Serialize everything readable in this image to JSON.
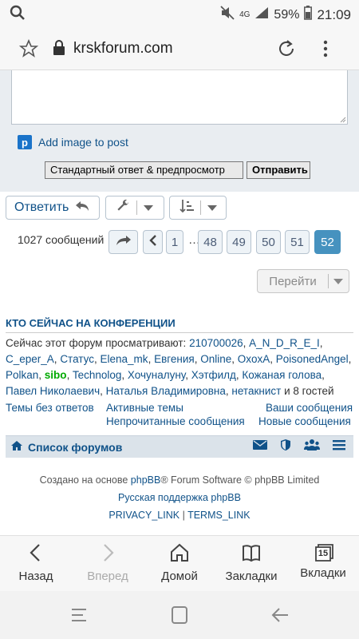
{
  "status_bar": {
    "battery": "59%",
    "time": "21:09",
    "network": "4G"
  },
  "browser": {
    "url": "krskforum.com"
  },
  "reply_form": {
    "add_image_label": "Add image to post",
    "preview_button": "Стандартный ответ & предпросмотр",
    "submit_button": "Отправить"
  },
  "actions": {
    "reply_label": "Ответить"
  },
  "pagination": {
    "post_count": "1027 сообщений",
    "ellipsis": "…",
    "pages": [
      "1",
      "48",
      "49",
      "50",
      "51",
      "52"
    ],
    "current_page": "52"
  },
  "jump": {
    "label": "Перейти"
  },
  "online": {
    "title": "КТО СЕЙЧАС НА КОНФЕРЕНЦИИ",
    "intro": "Сейчас этот форум просматривают: ",
    "users": [
      "210700026",
      "A_N_D_R_E_I",
      "C_eper_A",
      "Статус",
      "Elena_mk",
      "Евгения",
      "Online",
      "OxoxA",
      "PoisonedAngel",
      "Polkan",
      "sibo",
      "Technolog",
      "Хочуналуну",
      "Хэтфилд",
      "Кожаная голова",
      "Павел Николаевич",
      "Наталья Владимировна",
      "нетакнист"
    ],
    "highlighted_user": "sibo",
    "guests_text": " и 8 гостей"
  },
  "quick_links": {
    "unanswered": "Темы без ответов",
    "active": "Активные темы",
    "your_posts": "Ваши сообщения",
    "unread": "Непрочитанные сообщения",
    "new_posts": "Новые сообщения"
  },
  "footer": {
    "forum_list": "Список форумов",
    "powered_prefix": "Создано на основе ",
    "powered_link": "phpBB",
    "powered_suffix": "® Forum Software © phpBB Limited",
    "support": "Русская поддержка phpBB",
    "privacy": "PRIVACY_LINK",
    "pipe": " | ",
    "terms": "TERMS_LINK"
  },
  "browser_bar": {
    "back": "Назад",
    "forward": "Вперед",
    "home": "Домой",
    "bookmarks": "Закладки",
    "tabs": "Вкладки",
    "tab_count": "15"
  },
  "colors": {
    "link": "#105289",
    "active_page": "#4692bf",
    "panel": "#e9edf1",
    "online_green": "#00aa00"
  }
}
